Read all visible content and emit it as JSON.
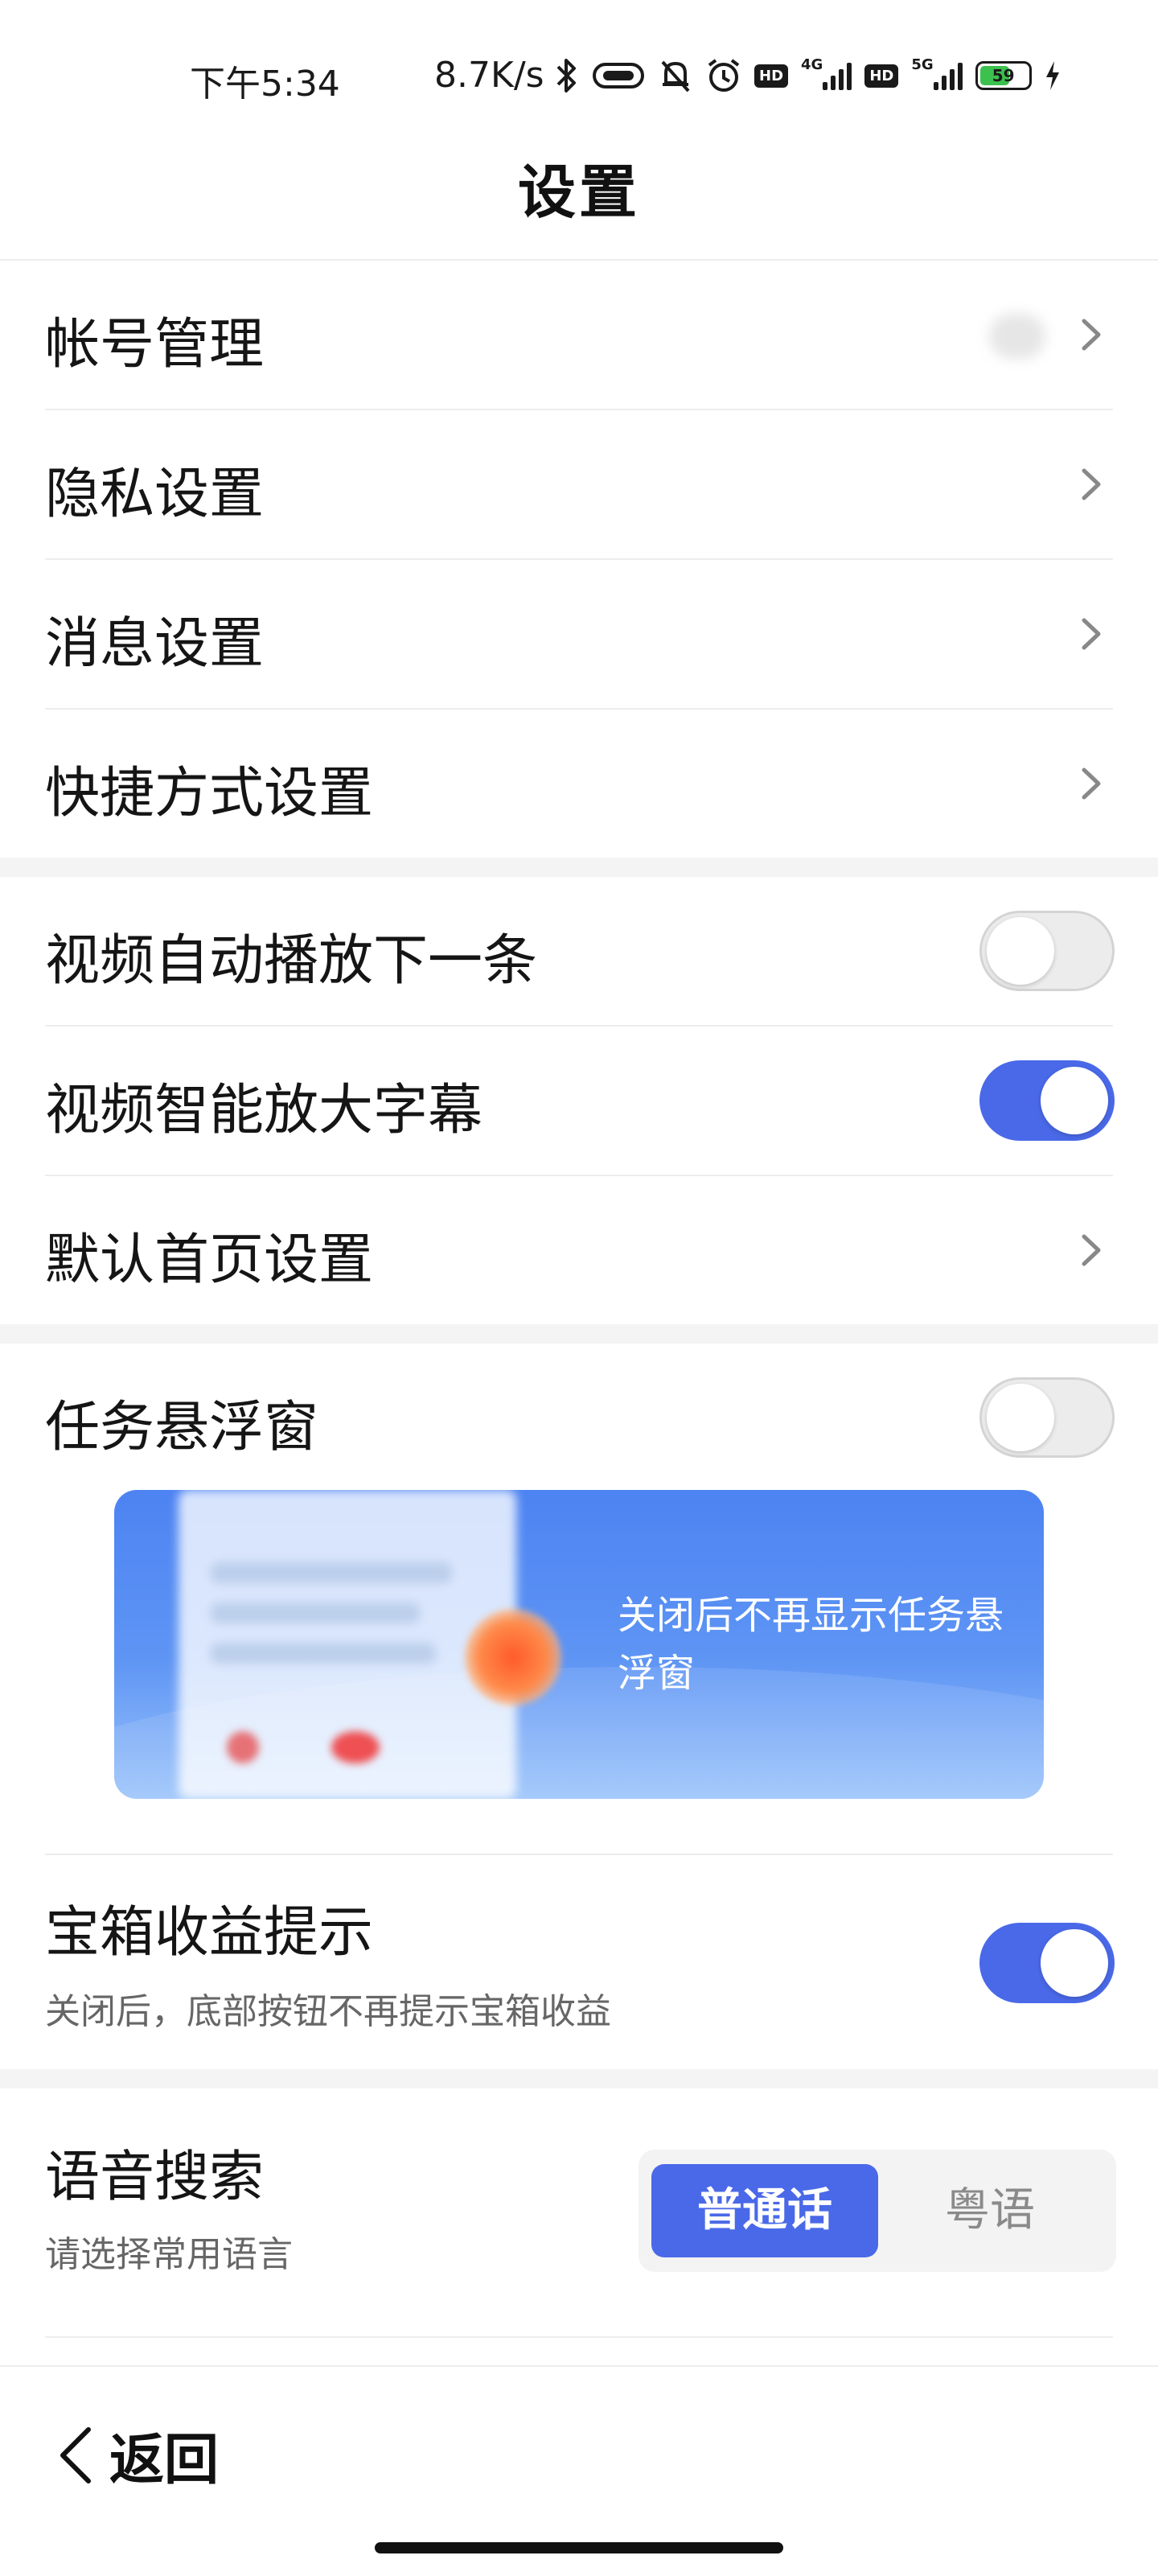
{
  "status_bar": {
    "time": "下午5:34",
    "speed": "8.7K/s",
    "hd1": "HD",
    "net1": "4G",
    "hd2": "HD",
    "net2": "5G",
    "battery": "59",
    "icons": [
      "bluetooth-icon",
      "vibrate-icon",
      "mute-icon",
      "alarm-icon",
      "hd-icon",
      "signal-icon",
      "hd-icon",
      "signal-icon",
      "battery-icon",
      "charging-icon"
    ]
  },
  "header": {
    "title": "设置"
  },
  "section1": [
    {
      "label": "帐号管理"
    },
    {
      "label": "隐私设置"
    },
    {
      "label": "消息设置"
    },
    {
      "label": "快捷方式设置"
    }
  ],
  "section2": {
    "autoplay_label": "视频自动播放下一条",
    "autoplay_on": false,
    "subtitle_label": "视频智能放大字幕",
    "subtitle_on": true,
    "homepage_label": "默认首页设置"
  },
  "section3": {
    "float_label": "任务悬浮窗",
    "float_on": false,
    "banner_text": "关闭后不再显示任务悬浮窗",
    "treasure_label": "宝箱收益提示",
    "treasure_sub": "关闭后，底部按钮不再提示宝箱收益",
    "treasure_on": true
  },
  "voice": {
    "label": "语音搜索",
    "sub": "请选择常用语言",
    "options": [
      "普通话",
      "粤语"
    ],
    "selected": "普通话"
  },
  "footer": {
    "back_label": "返回"
  },
  "colors": {
    "accent": "#4a69e8",
    "divider": "#ededed",
    "section_gap": "#f4f4f4"
  }
}
